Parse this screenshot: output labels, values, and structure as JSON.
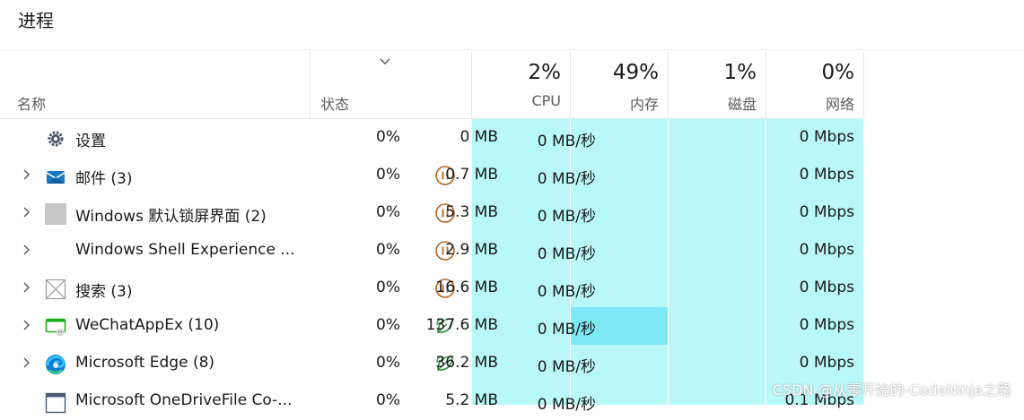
{
  "page": {
    "title": "进程"
  },
  "header": {
    "name_label": "名称",
    "status_label": "状态",
    "cpu": {
      "pct": "2%",
      "label": "CPU"
    },
    "memory": {
      "pct": "49%",
      "label": "内存"
    },
    "disk": {
      "pct": "1%",
      "label": "磁盘"
    },
    "network": {
      "pct": "0%",
      "label": "网络"
    }
  },
  "rows": [
    {
      "name": "设置",
      "icon": "gear-icon",
      "status": "",
      "cpu": "0%",
      "memory": "0 MB",
      "disk": "0 MB/秒",
      "network": "0 Mbps"
    },
    {
      "name": "邮件 (3)",
      "icon": "mail-icon",
      "status": "suspended-icon",
      "cpu": "0%",
      "memory": "0.7 MB",
      "disk": "0 MB/秒",
      "network": "0 Mbps"
    },
    {
      "name": "Windows 默认锁屏界面 (2)",
      "icon": "gray-square-icon",
      "status": "suspended-icon",
      "cpu": "0%",
      "memory": "5.3 MB",
      "disk": "0 MB/秒",
      "network": "0 Mbps"
    },
    {
      "name": "Windows Shell Experience ...",
      "icon": "",
      "status": "suspended-icon",
      "cpu": "0%",
      "memory": "2.9 MB",
      "disk": "0 MB/秒",
      "network": "0 Mbps"
    },
    {
      "name": "搜索 (3)",
      "icon": "search-placeholder-icon",
      "status": "suspended-icon",
      "cpu": "0%",
      "memory": "16.6 MB",
      "disk": "0 MB/秒",
      "network": "0 Mbps"
    },
    {
      "name": "WeChatAppEx (10)",
      "icon": "wechat-app-icon",
      "status": "efficiency-leaf-icon",
      "cpu": "0%",
      "memory": "137.6 MB",
      "disk": "0 MB/秒",
      "network": "0 Mbps"
    },
    {
      "name": "Microsoft Edge (8)",
      "icon": "edge-icon",
      "status": "efficiency-leaf-icon",
      "cpu": "0%",
      "memory": "36.2 MB",
      "disk": "0 MB/秒",
      "network": "0 Mbps"
    },
    {
      "name": "Microsoft OneDriveFile Co-...",
      "icon": "onedrive-app-icon",
      "status": "",
      "cpu": "0%",
      "memory": "5.2 MB",
      "disk": "0 MB/秒",
      "network": "0.1 Mbps"
    }
  ],
  "watermark": "CSDN @从零开始的-CodeNinja之路",
  "colors": {
    "heat": "#b8f8f8",
    "heat_high": "#7fe8f5",
    "status_suspended": "#b5651d",
    "status_eco": "#2e8b3d"
  }
}
